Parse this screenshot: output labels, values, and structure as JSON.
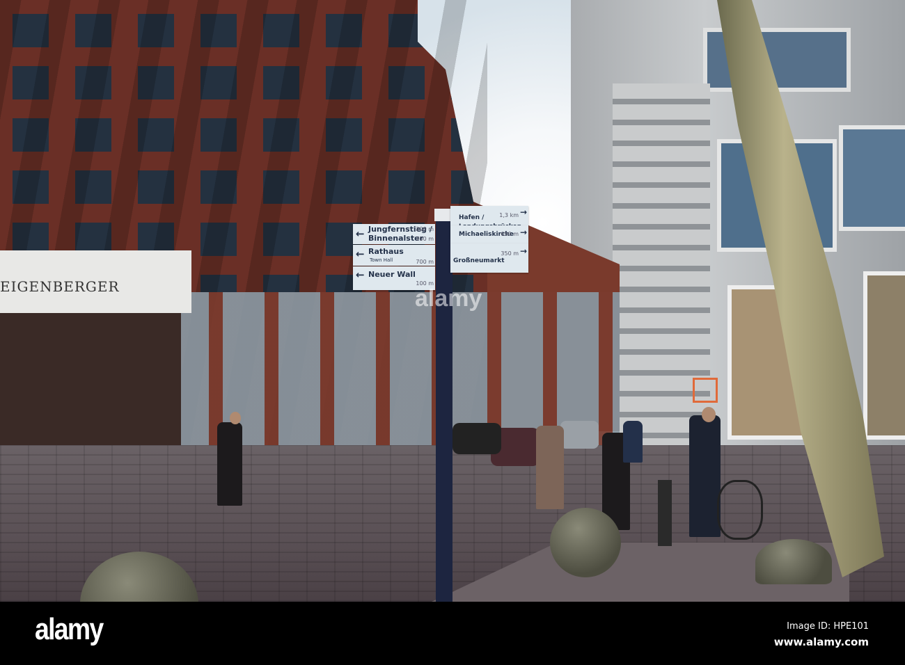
{
  "photo": {
    "hotel_sign": "EIGENBERGER",
    "signpost": {
      "left_signs": [
        {
          "name": "Jungfernstieg /",
          "distance": "200 m"
        },
        {
          "name": "Binnenalster",
          "distance": "700 m"
        },
        {
          "name": "Rathaus",
          "subtitle": "Town Hall",
          "distance": "700 m"
        },
        {
          "name": "Neuer Wall",
          "distance": "100 m"
        }
      ],
      "right_signs": [
        {
          "name": "Hafen /",
          "distance": "1,3 km"
        },
        {
          "name": "Landungsbrücken"
        },
        {
          "name": "Michaeliskirche",
          "distance": "650 m"
        },
        {
          "name": "Großneumarkt",
          "distance": "350 m"
        }
      ],
      "left_arrow": "←",
      "right_arrow": "→"
    }
  },
  "watermark": {
    "logo": "alamy",
    "overlay_text": "alamy",
    "image_id": "Image ID: HPE101",
    "url": "www.alamy.com"
  }
}
